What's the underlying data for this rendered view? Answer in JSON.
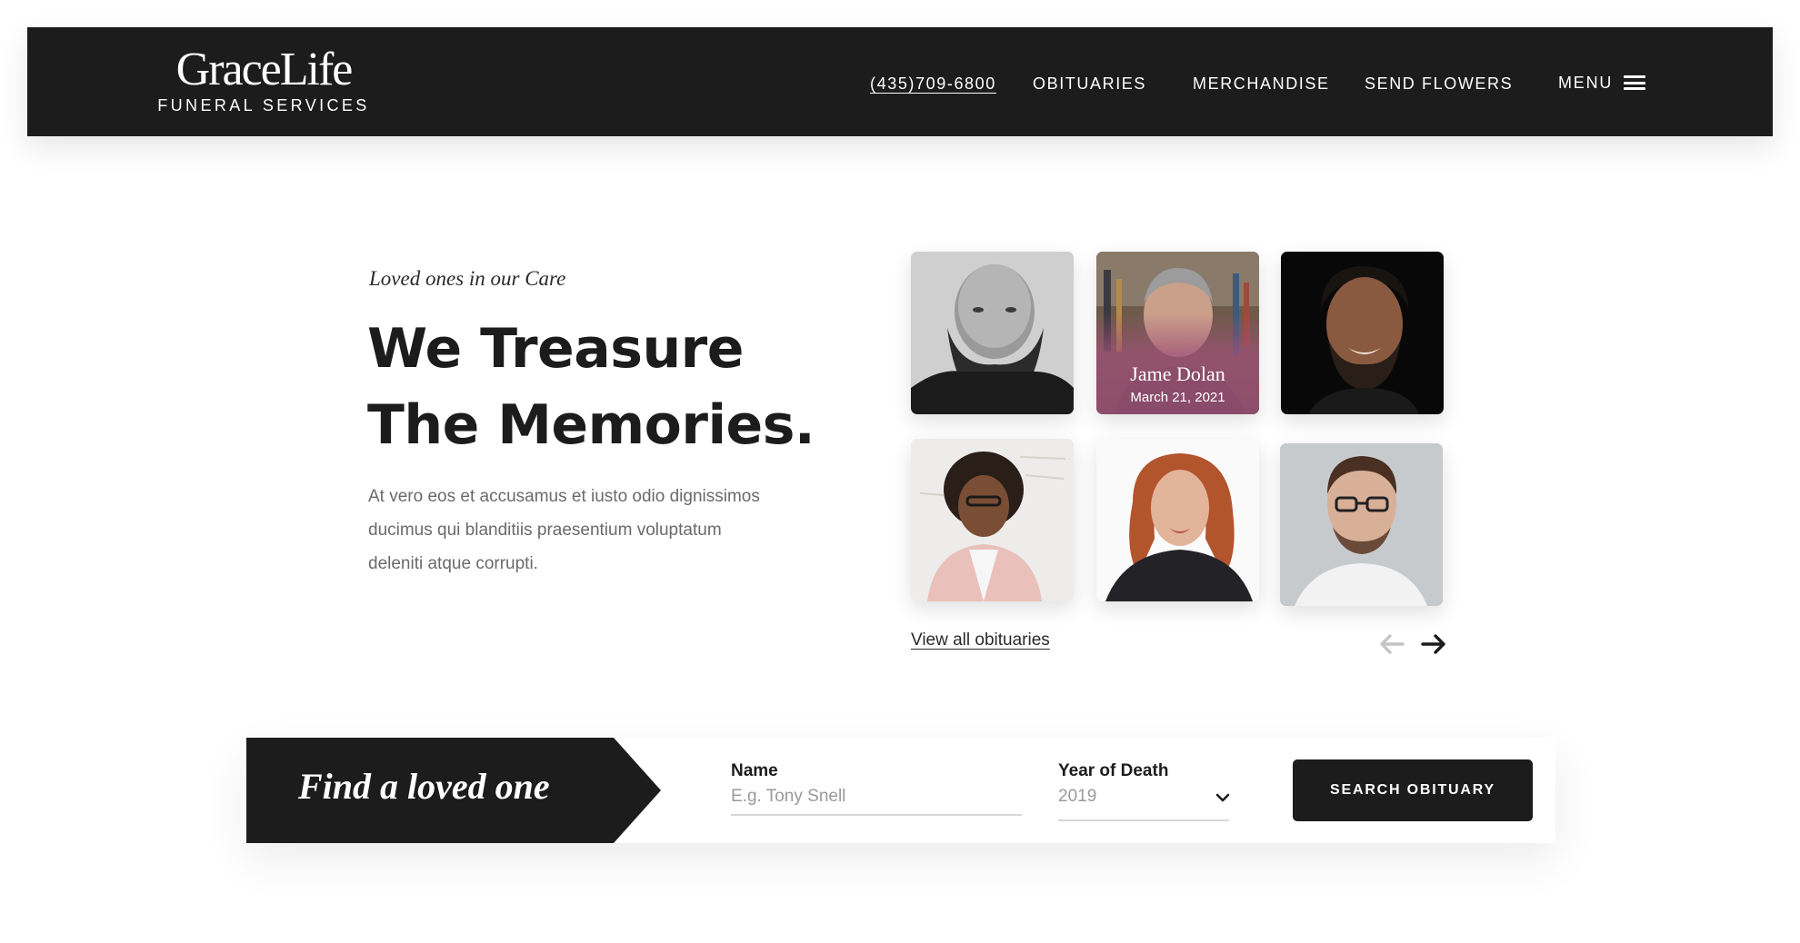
{
  "header": {
    "logo_name": "GraceLife",
    "logo_sub": "FUNERAL SERVICES",
    "nav": {
      "phone": "(435)709-6800",
      "obituaries": "OBITUARIES",
      "merchandise": "MERCHANDISE",
      "send_flowers": "SEND FLOWERS"
    },
    "menu_label": "MENU"
  },
  "hero": {
    "eyebrow": "Loved ones in our Care",
    "headline_line1": "We Treasure",
    "headline_line2": "The Memories.",
    "intro_line1": "At vero eos et accusamus et iusto odio dignissimos",
    "intro_line2": "ducimus qui blanditiis praesentium voluptatum",
    "intro_line3": "deleniti atque corrupti."
  },
  "obituaries": {
    "featured": {
      "name": "Jame Dolan",
      "date": "March 21, 2021"
    },
    "view_all": "View all obituaries"
  },
  "search": {
    "badge_text": "Find a loved one",
    "name_label": "Name",
    "name_placeholder": "E.g. Tony Snell",
    "year_label": "Year of Death",
    "year_value": "2019",
    "button_label": "SEARCH OBITUARY"
  },
  "colors": {
    "dark": "#1c1c1c",
    "caption_overlay": "#a0507a",
    "text_muted": "#6a6a6a",
    "arrow_disabled": "#c4c4c4"
  }
}
